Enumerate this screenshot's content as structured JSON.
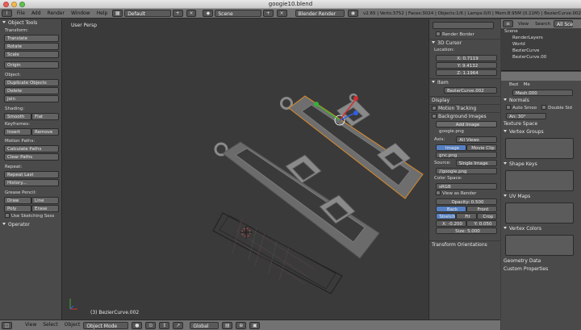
{
  "window": {
    "title": "googie10.blend"
  },
  "info_header": {
    "menus": [
      "File",
      "Add",
      "Render",
      "Window",
      "Help"
    ],
    "screen_layout": "Default",
    "scene": "Scene",
    "render_engine": "Blender Render",
    "stats": "v2.65 | Verts:3752 | Faces:3024 | Objects:1/6 | Lamps:0/0 | Mem:8.95M (0.11M) | BezierCurve.002"
  },
  "tool_shelf": {
    "title": "Object Tools",
    "sections": [
      {
        "label": "Transform:",
        "buttons": [
          "Translate",
          "Rotate",
          "Scale"
        ]
      },
      {
        "label": "",
        "buttons": [
          "Origin"
        ]
      },
      {
        "label": "Object:",
        "buttons": [
          "Duplicate Objects",
          "Delete",
          "Join"
        ]
      },
      {
        "label": "Shading:",
        "pairs": [
          [
            "Smooth",
            "Flat"
          ]
        ]
      },
      {
        "label": "Keyframes:",
        "pairs": [
          [
            "Insert",
            "Remove"
          ]
        ]
      },
      {
        "label": "Motion Paths:",
        "buttons": [
          "Calculate Paths",
          "Clear Paths"
        ]
      },
      {
        "label": "Repeat:",
        "buttons": [
          "Repeat Last",
          "History..."
        ]
      },
      {
        "label": "Grease Pencil:",
        "pairs": [
          [
            "Draw",
            "Line"
          ],
          [
            "Poly",
            "Erase"
          ]
        ]
      }
    ],
    "sketch_label": "Use Sketching Sess",
    "operator_label": "Operator"
  },
  "viewport": {
    "view_label": "User Persp",
    "object_label": "(3) BezierCurve.002"
  },
  "view3d_header": {
    "menus": [
      "View",
      "Select",
      "Object"
    ],
    "mode": "Object Mode",
    "orientation": "Global"
  },
  "properties_panel": {
    "render_border": "Render Border",
    "cursor_title": "3D Cursor",
    "location_label": "Location:",
    "x": "X: 0.7119",
    "y": "Y: 9.4132",
    "z": "Z: 1.1964",
    "item_title": "Item",
    "item_name": "BezierCurve.002",
    "display": "Display",
    "motion_tracking": "Motion Tracking",
    "background_images": "Background Images",
    "add_image": "Add Image",
    "image_name": "googie.png",
    "axis_label": "Axis:",
    "axis_value": "All Views",
    "tab_image": "Image",
    "tab_movie": "Movie Clip",
    "file_name": "gnc.png",
    "source_label": "Source:",
    "source_value": "Single Image",
    "path": "//googie.png",
    "color_space_label": "Color Space:",
    "color_space": "sRGB",
    "view_as_render": "View as Render",
    "opacity": "Opacity: 0.500",
    "back": "Back",
    "front": "Front",
    "stretch": "Stretch",
    "fit": "Fit",
    "crop": "Crop",
    "x_off": "X: -0.200",
    "y_off": "Y: 0.050",
    "size": "Size: 5.000",
    "transform_orientations": "Transform Orientations"
  },
  "outliner": {
    "menus": [
      "View",
      "Search"
    ],
    "filter": "All Sce",
    "items": [
      "Scene",
      "RenderLayers",
      "World",
      "BezierCurve",
      "BezierCurve.00"
    ]
  },
  "data_props": {
    "context": "Bezi",
    "context2": "Me",
    "mesh_name": "Mesh.000",
    "normals": "Normals",
    "auto_smooth": "Auto Smoo",
    "double_sided": "Double Sid",
    "angle": "An: 30°",
    "texture_space": "Texture Space",
    "vertex_groups": "Vertex Groups",
    "shape_keys": "Shape Keys",
    "uv_maps": "UV Maps",
    "vertex_colors": "Vertex Colors",
    "geometry_data": "Geometry Data",
    "custom_properties": "Custom Properties"
  }
}
